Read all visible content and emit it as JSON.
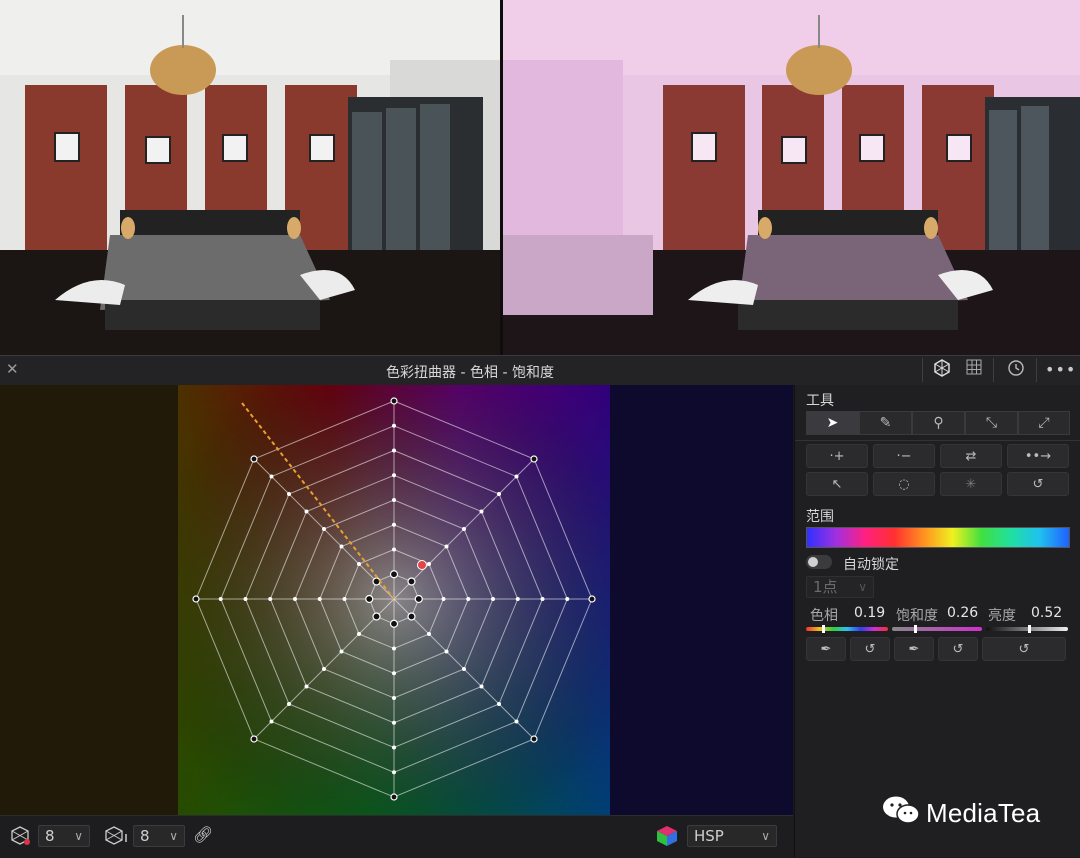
{
  "title": "色彩扭曲器 - 色相 - 饱和度",
  "toolbar_icons": [
    "warper-icon",
    "grid-icon",
    "history-reset-icon",
    "more-icon"
  ],
  "panel": {
    "tools_label": "工具",
    "range_label": "范围",
    "autolock_label": "自动锁定",
    "points_label": "1点",
    "hue_label": "色相",
    "hue_value": "0.19",
    "sat_label": "饱和度",
    "sat_value": "0.26",
    "lum_label": "亮度",
    "lum_value": "0.52"
  },
  "bottom": {
    "hue_count": "8",
    "sat_count": "8",
    "mode": "HSP"
  },
  "brand": "MediaTea",
  "colors": {
    "accent_point": "#e24545",
    "guide_line": "#e8a030"
  }
}
